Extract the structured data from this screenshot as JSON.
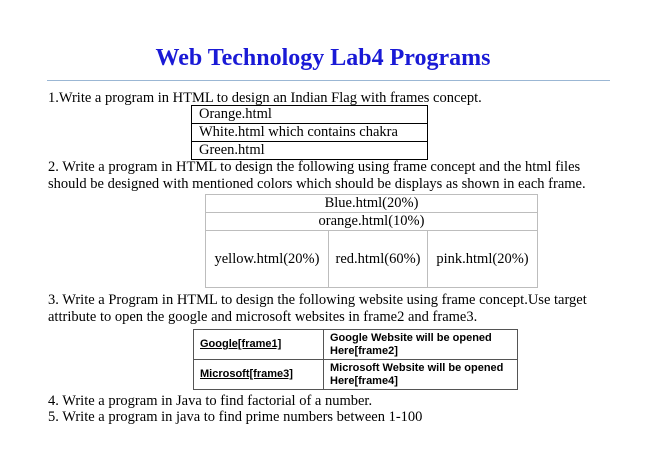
{
  "title": "Web Technology Lab4 Programs",
  "q1": "1.Write a program in HTML to design an Indian Flag with frames concept.",
  "q1_table": [
    "Orange.html",
    "White.html which contains chakra",
    "Green.html"
  ],
  "q2_line1": "2.  Write a program in HTML to design the following using frame concept and the html files",
  "q2_line2": "should be designed with mentioned colors which should be displays as shown in each frame.",
  "q2_table": {
    "row1": "Blue.html(20%)",
    "row2": "orange.html(10%)",
    "row3": [
      "yellow.html(20%)",
      "red.html(60%)",
      "pink.html(20%)"
    ]
  },
  "q3_line1": "3.  Write a Program in HTML to design the following website using frame concept.Use target",
  "q3_line2": "attribute to open the google and microsoft websites in frame2 and frame3.",
  "q3_table": [
    {
      "link": "Google[frame1]",
      "target": "Google Website will be opened Here[frame2]"
    },
    {
      "link": "Microsoft[frame3]",
      "target": "Microsoft Website will be opened Here[frame4]"
    }
  ],
  "q4": "4.  Write a program in Java to find factorial of a number.",
  "q5": "5.  Write a program in java to find prime numbers between 1-100"
}
